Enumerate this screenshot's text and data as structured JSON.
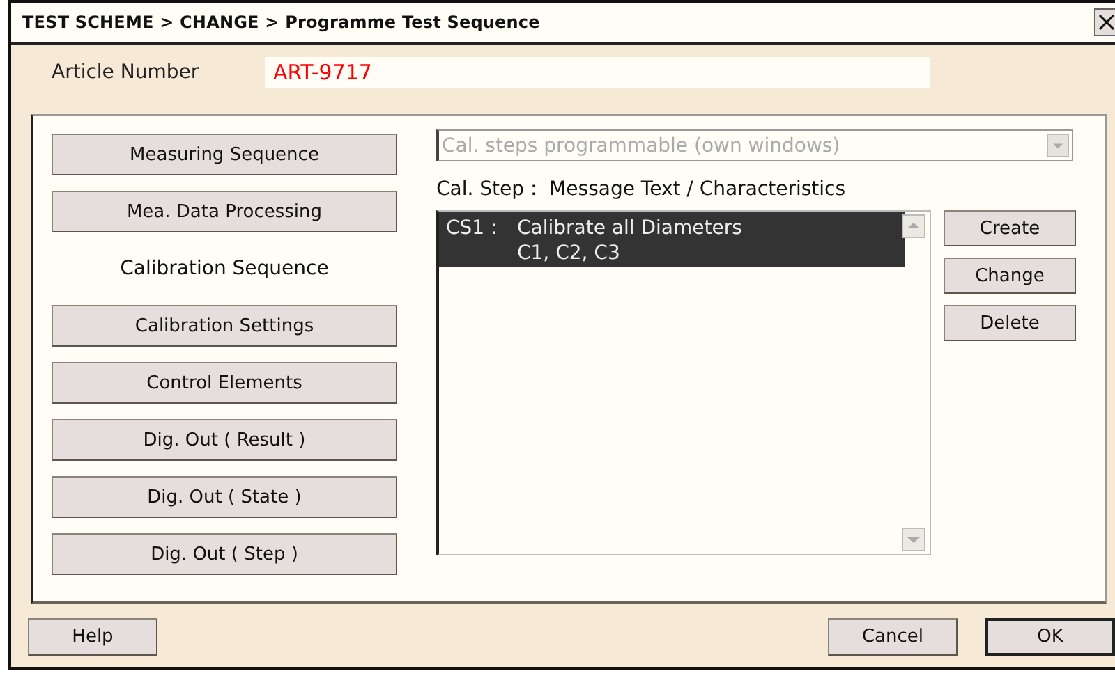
{
  "window": {
    "title": "TEST SCHEME > CHANGE > Programme Test Sequence"
  },
  "article": {
    "label": "Article Number",
    "value": "ART-9717"
  },
  "nav": [
    {
      "label": "Measuring Sequence",
      "selected": false
    },
    {
      "label": "Mea. Data Processing",
      "selected": false
    },
    {
      "label": "Calibration Sequence",
      "selected": true
    },
    {
      "label": "Calibration Settings",
      "selected": false
    },
    {
      "label": "Control Elements",
      "selected": false
    },
    {
      "label": "Dig. Out ( Result )",
      "selected": false
    },
    {
      "label": "Dig. Out ( State )",
      "selected": false
    },
    {
      "label": "Dig. Out ( Step )",
      "selected": false
    }
  ],
  "mode_dropdown": {
    "value": "Cal. steps programmable (own windows)",
    "disabled": true
  },
  "list_header": "Cal. Step :  Message Text / Characteristics",
  "steps": [
    {
      "code": "CS1 :",
      "lines": [
        "Calibrate all Diameters",
        "C1, C2, C3"
      ],
      "selected": true
    }
  ],
  "step_buttons": [
    "Create",
    "Change",
    "Delete"
  ],
  "footer": {
    "help": "Help",
    "cancel": "Cancel",
    "ok": "OK"
  }
}
